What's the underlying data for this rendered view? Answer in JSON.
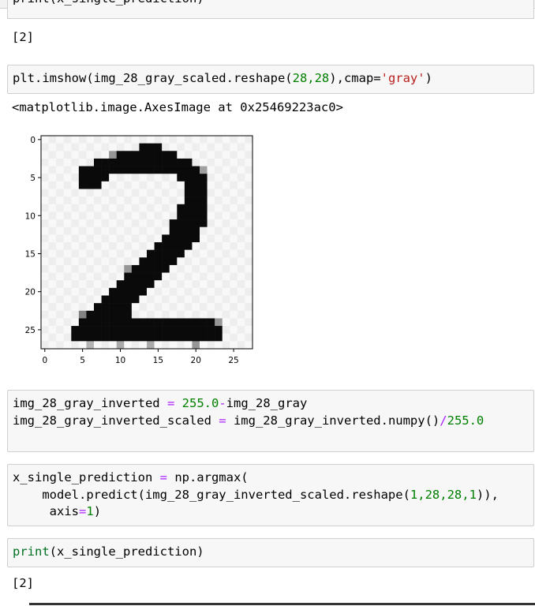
{
  "cells": {
    "prev_input_partial": "print(x_single_prediction)",
    "prev_output": "[2]",
    "imshow_input": {
      "fn": "plt.imshow(img_28_gray_scaled.reshape(",
      "args": "28,28",
      "mid": "),cmap=",
      "str": "'gray'",
      "end": ")"
    },
    "imshow_output": "<matplotlib.image.AxesImage at 0x25469223ac0>",
    "invert_line1": {
      "lhs": "img_28_gray_inverted ",
      "eq": "=",
      "sp": " ",
      "num": "255.0",
      "minus": "-",
      "rhs": "img_28_gray"
    },
    "invert_line2": {
      "lhs": "img_28_gray_inverted_scaled ",
      "eq": "=",
      "mid": " img_28_gray_inverted.numpy()",
      "div": "/",
      "num": "255.0"
    },
    "predict_input": {
      "line1a": "x_single_prediction ",
      "line1eq": "=",
      "line1b": " np.argmax(",
      "line2a": "    model.predict(img_28_gray_inverted_scaled.reshape(",
      "line2nums": "1,28,28,1",
      "line2b": ")),",
      "line3a": "     axis",
      "line3eq": "=",
      "line3num": "1",
      "line3b": ")"
    },
    "print_input": {
      "fn": "print",
      "rest": "(x_single_prediction)"
    },
    "print_output": "[2]"
  },
  "plot": {
    "x_ticks": [
      "0",
      "5",
      "10",
      "15",
      "20",
      "25"
    ],
    "y_ticks": [
      "0",
      "5",
      "10",
      "15",
      "20",
      "25"
    ]
  }
}
